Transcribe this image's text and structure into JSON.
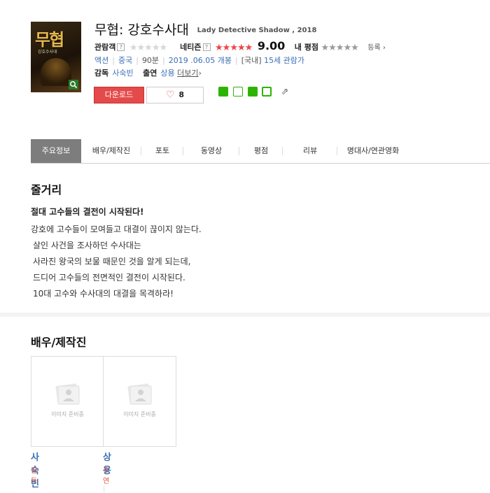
{
  "movie": {
    "title": "무협: 강호수사대",
    "original_title": "Lady Detective Shadow , 2018",
    "poster_title": "무협",
    "poster_subtitle": "강호수사대"
  },
  "ratings": {
    "audience_label": "관람객",
    "audience_help": "?",
    "netizen_label": "네티즌",
    "netizen_help": "?",
    "netizen_score": "9.00",
    "my_rating_label": "내 평점",
    "register_label": "등록 ›"
  },
  "info": {
    "genre": "액션",
    "country": "중국",
    "runtime": "90분",
    "release": "2019 .06.05 개봉",
    "rating_prefix": "[국내]",
    "age_rating": "15세 관람가"
  },
  "credits": {
    "director_label": "감독",
    "director": "사숙빈",
    "cast_label": "출연",
    "cast": "상용",
    "more_label": "더보기",
    "more_arrow": "›"
  },
  "actions": {
    "download_label": "다운로드",
    "like_count": "8"
  },
  "tabs": [
    {
      "label": "주요정보",
      "active": true
    },
    {
      "label": "배우/제작진",
      "active": false
    },
    {
      "label": "포토",
      "active": false
    },
    {
      "label": "동영상",
      "active": false
    },
    {
      "label": "평점",
      "active": false
    },
    {
      "label": "리뷰",
      "active": false
    },
    {
      "label": "명대사/연관영화",
      "active": false
    }
  ],
  "story": {
    "heading": "줄거리",
    "headline": "절대 고수들의 결전이 시작된다!",
    "lines": [
      "강호에 고수들이 모여들고 대결이 끊이지 않는다.",
      "살인 사건을 조사하던 수사대는",
      "사라진 왕국의 보물 때문인 것을 알게 되는데,",
      "드디어 고수들의 전면적인 결전이 시작된다.",
      "10대 고수와 수사대의 대결을 목격하라!"
    ]
  },
  "cast_section": {
    "heading": "배우/제작진",
    "placeholder_text": "이미지 준비중",
    "people": [
      {
        "name": "사숙빈",
        "role": "감독"
      },
      {
        "name": "상용",
        "role": "주연"
      }
    ]
  },
  "colors": {
    "accent_red": "#e44a4a",
    "link_blue": "#3b6fb5",
    "share_green": "#2db400",
    "tab_active": "#7d7d7d"
  },
  "icons": [
    "search-icon",
    "heart-icon",
    "blog-share-icon",
    "talk-share-icon",
    "star-share-icon",
    "square-share-icon",
    "external-share-icon",
    "person-placeholder-icon"
  ]
}
